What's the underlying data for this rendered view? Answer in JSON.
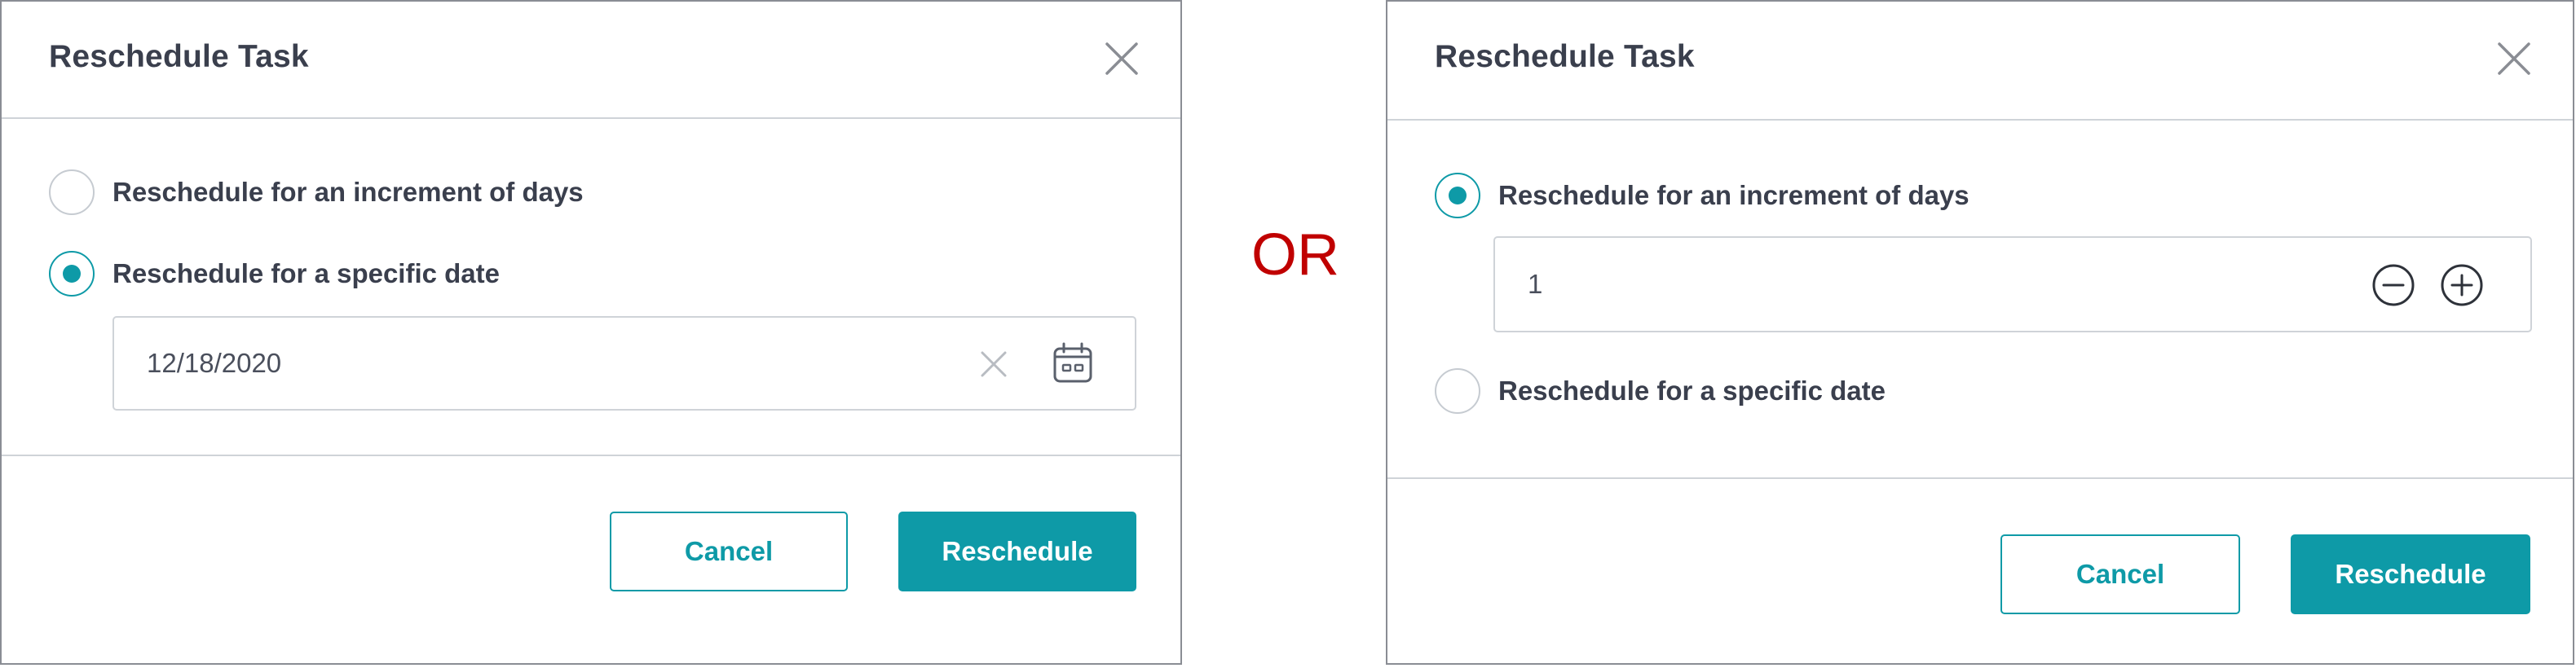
{
  "separator": {
    "text": "OR",
    "color": "#c00000"
  },
  "colors": {
    "accent": "#0e9aa7",
    "text": "#3a3f4d",
    "border": "#cfd3d8"
  },
  "dialogs": [
    {
      "title": "Reschedule Task",
      "close_icon": "close-icon",
      "options": [
        {
          "label": "Reschedule for an increment of days",
          "selected": false
        },
        {
          "label": "Reschedule for a specific date",
          "selected": true
        }
      ],
      "date_field": {
        "value": "12/18/2020",
        "clear_icon": "clear-icon",
        "calendar_icon": "calendar-icon"
      },
      "cancel_label": "Cancel",
      "submit_label": "Reschedule"
    },
    {
      "title": "Reschedule Task",
      "close_icon": "close-icon",
      "options": [
        {
          "label": "Reschedule for an increment of days",
          "selected": true
        },
        {
          "label": "Reschedule for a specific date",
          "selected": false
        }
      ],
      "days_field": {
        "value": "1",
        "decrement_icon": "minus-circle-icon",
        "increment_icon": "plus-circle-icon"
      },
      "cancel_label": "Cancel",
      "submit_label": "Reschedule"
    }
  ]
}
